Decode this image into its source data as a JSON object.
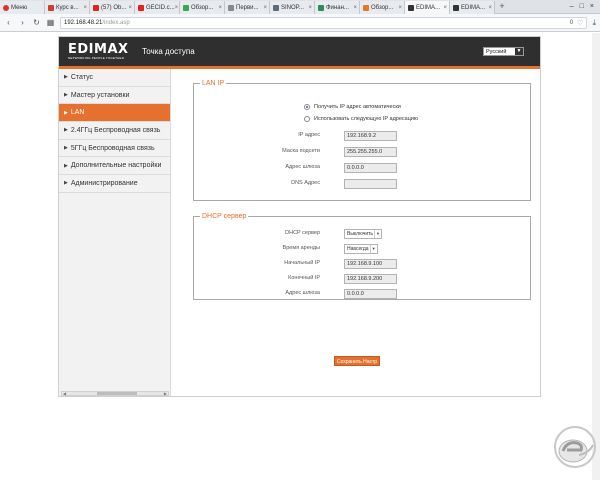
{
  "browser": {
    "tabs": [
      {
        "label": "Меню",
        "color": "#e0312b",
        "active": false
      },
      {
        "label": "Курс в...",
        "color": "#d33b2c",
        "active": false
      },
      {
        "label": "(57) Ob...",
        "color": "#e62117",
        "active": false
      },
      {
        "label": "GECID.c...",
        "color": "#e62117",
        "active": false
      },
      {
        "label": "Обзор...",
        "color": "#3aa757",
        "active": false
      },
      {
        "label": "Перви...",
        "color": "#8a8a8a",
        "active": false
      },
      {
        "label": "SINOP...",
        "color": "#5f6a7a",
        "active": false
      },
      {
        "label": "Финан...",
        "color": "#2e8b57",
        "active": false
      },
      {
        "label": "Обзор...",
        "color": "#e87722",
        "active": false
      },
      {
        "label": "EDIMA...",
        "color": "#333333",
        "active": true
      },
      {
        "label": "EDIMA...",
        "color": "#333333",
        "active": false
      }
    ],
    "url_host": "192.168.48.21",
    "url_path": "/index.asp",
    "url_badge": "0"
  },
  "router": {
    "logo": "EDIMAX",
    "logo_tagline": "NETWORKING PEOPLE TOGETHER",
    "page_title": "Точка доступа",
    "language": "Русский",
    "accent_color": "#e6702e",
    "nav": [
      {
        "label": "Статус",
        "active": false
      },
      {
        "label": "Мастер установки",
        "active": false
      },
      {
        "label": "LAN",
        "active": true
      },
      {
        "label": "2.4ГГц Беспроводная связь",
        "active": false
      },
      {
        "label": "5ГГц Беспроводная связь",
        "active": false
      },
      {
        "label": "Дополнительные настройки",
        "active": false
      },
      {
        "label": "Администрирование",
        "active": false
      }
    ],
    "lan": {
      "legend": "LAN IP",
      "radio_auto": "Получить IP адрес автоматически",
      "radio_manual": "Использовать следующую IP адресацию",
      "ip_label": "IP адрес",
      "ip_value": "192.168.9.2",
      "mask_label": "Маска подсети",
      "mask_value": "255.255.255.0",
      "gateway_label": "Адрес шлюза",
      "gateway_value": "0.0.0.0",
      "dns_label": "DNS  Адрес",
      "dns_value": ""
    },
    "dhcp": {
      "legend": "DHCP сервер",
      "server_label": "DHCP сервер",
      "server_value": "Выключить",
      "lease_label": "Время аренды",
      "lease_value": "Навсегда",
      "start_label": "Начальный IP",
      "start_value": "192.168.9.100",
      "end_label": "Конечный IP",
      "end_value": "192.168.9.200",
      "gateway_label": "Адрес шлюза",
      "gateway_value": "0.0.0.0"
    },
    "save_label": "Сохранить Настр"
  },
  "watermark": "GECID"
}
